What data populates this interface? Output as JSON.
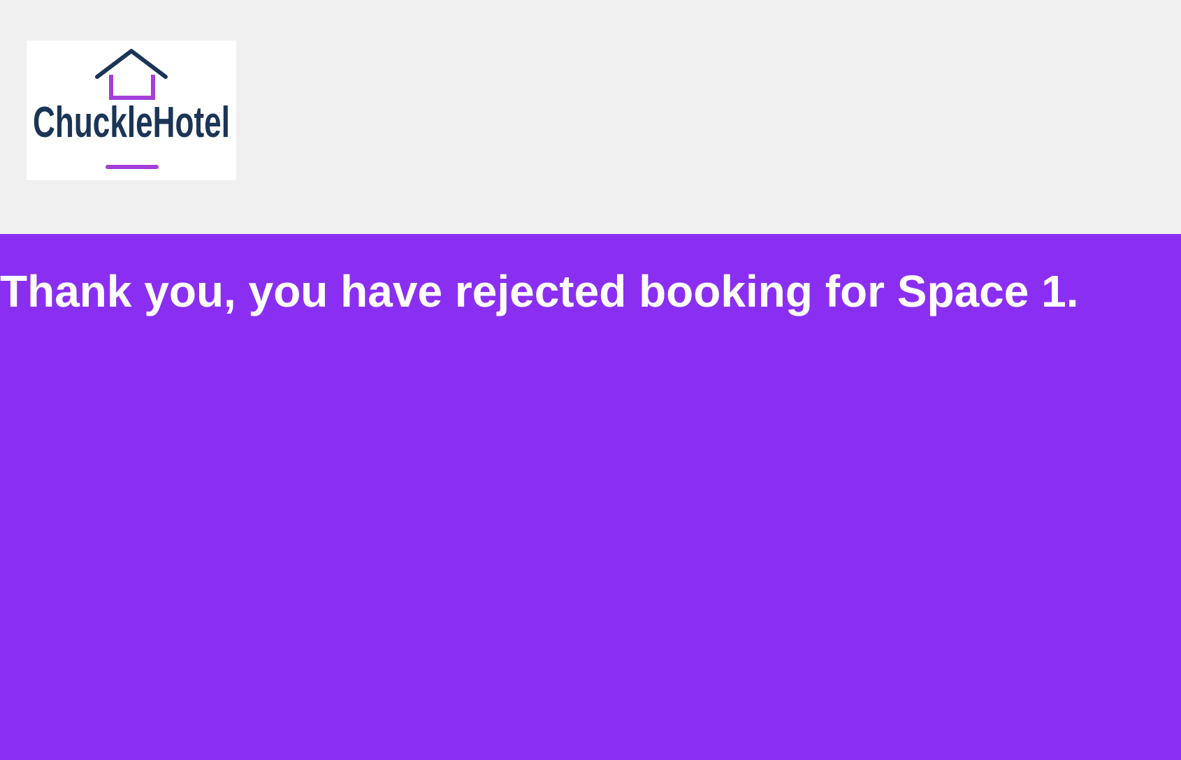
{
  "logo": {
    "text": "ChuckleHotel",
    "text_color": "#1b3556",
    "accent_color": "#a43fd9",
    "background": "#ffffff"
  },
  "main": {
    "background": "#8a2ff2",
    "message": "Thank you, you have rejected booking for Space 1."
  },
  "header": {
    "background": "#f0f0f0"
  }
}
